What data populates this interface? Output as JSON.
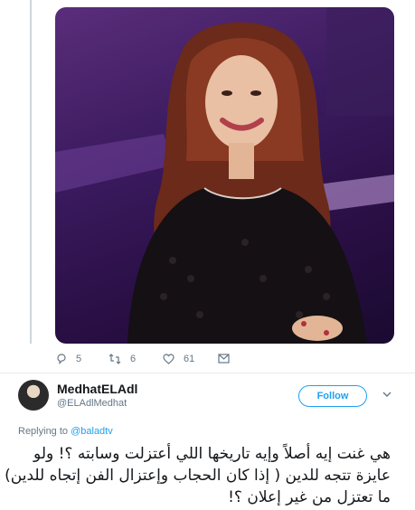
{
  "tweet": {
    "photo_alt": "Photo of a smiling woman with long auburn hair in a black lace dress",
    "actions": {
      "reply_count": "5",
      "retweet_count": "6",
      "like_count": "61"
    }
  },
  "reply": {
    "user": {
      "name": "MedhatELAdl",
      "handle": "@ELAdlMedhat"
    },
    "follow_label": "Follow",
    "replying_to_prefix": "Replying to ",
    "replying_to_mention": "@baladtv",
    "text_lines": [
      "هي غنت إيه أصلاً وإيه تاريخها اللي أعتزلت وسابته ؟! ولو",
      "عايزة تتجه للدين ( إذا كان الحجاب وإعتزال الفن إتجاه للدين)",
      "ما تعتزل من غير إعلان ؟!"
    ]
  },
  "colors": {
    "accent": "#1da1f2",
    "secondary_text": "#657786",
    "divider": "#e6ecf0"
  },
  "icons": [
    "reply-icon",
    "retweet-icon",
    "like-icon",
    "message-icon",
    "chevron-down-icon"
  ]
}
